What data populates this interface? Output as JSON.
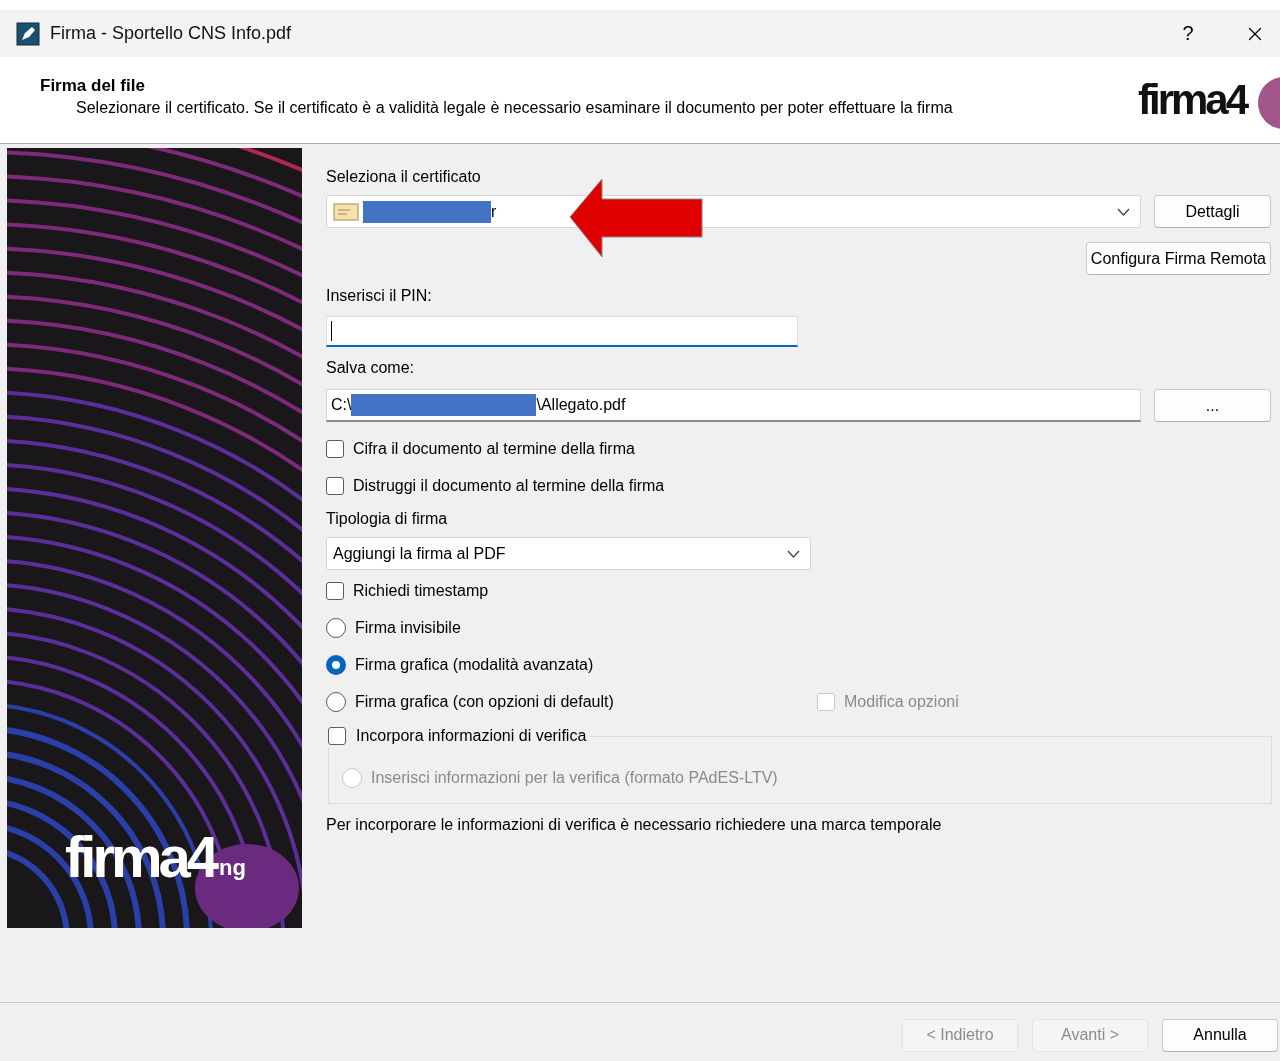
{
  "window": {
    "title": "Firma - Sportello CNS Info.pdf",
    "help": "?"
  },
  "header": {
    "title": "Firma del file",
    "description": "Selezionare il certificato. Se il certificato è a validità legale è necessario esaminare il documento per poter effettuare la firma",
    "logo": "firma4"
  },
  "side_panel": {
    "logo": "firma4",
    "logo_suffix": "ng"
  },
  "certificate": {
    "label": "Seleziona il certificato",
    "value": "r",
    "redacted": true,
    "details_button": "Dettagli",
    "remote_button": "Configura Firma Remota"
  },
  "pin": {
    "label": "Inserisci il PIN:",
    "focused": true
  },
  "save_as": {
    "label": "Salva come:",
    "prefix": "C:\\",
    "suffix": "\\Allegato.pdf",
    "redacted": true,
    "browse_button": "..."
  },
  "top_options": [
    {
      "kind": "checkbox",
      "label": "Cifra il documento al termine della firma",
      "checked": false,
      "disabled": false
    },
    {
      "kind": "checkbox",
      "label": "Distruggi il documento al termine della firma",
      "checked": false,
      "disabled": false
    }
  ],
  "signature_type": {
    "label": "Tipologia di firma",
    "value": "Aggiungi la firma al PDF"
  },
  "options": [
    {
      "kind": "checkbox",
      "label": "Richiedi timestamp",
      "checked": false,
      "disabled": false
    },
    {
      "kind": "radio",
      "label": "Firma invisibile",
      "selected": false,
      "disabled": false
    },
    {
      "kind": "radio",
      "label": "Firma grafica (modalità avanzata)",
      "selected": true,
      "disabled": false
    },
    {
      "kind": "radio",
      "label": "Firma grafica (con opzioni di default)",
      "selected": false,
      "disabled": false,
      "side_option": {
        "label": "Modifica opzioni",
        "checked": false,
        "disabled": true
      }
    }
  ],
  "verification_group": {
    "label": "Incorpora informazioni di verifica",
    "checked": false,
    "option": {
      "label": "Inserisci informazioni per la verifica (formato PAdES-LTV)",
      "selected": false,
      "disabled": true
    }
  },
  "note": "Per incorporare le informazioni di verifica è necessario richiedere una marca temporale",
  "footer_buttons": [
    {
      "label": "< Indietro",
      "disabled": true
    },
    {
      "label": "Avanti >",
      "disabled": true
    },
    {
      "label": "Annulla",
      "disabled": false
    }
  ]
}
